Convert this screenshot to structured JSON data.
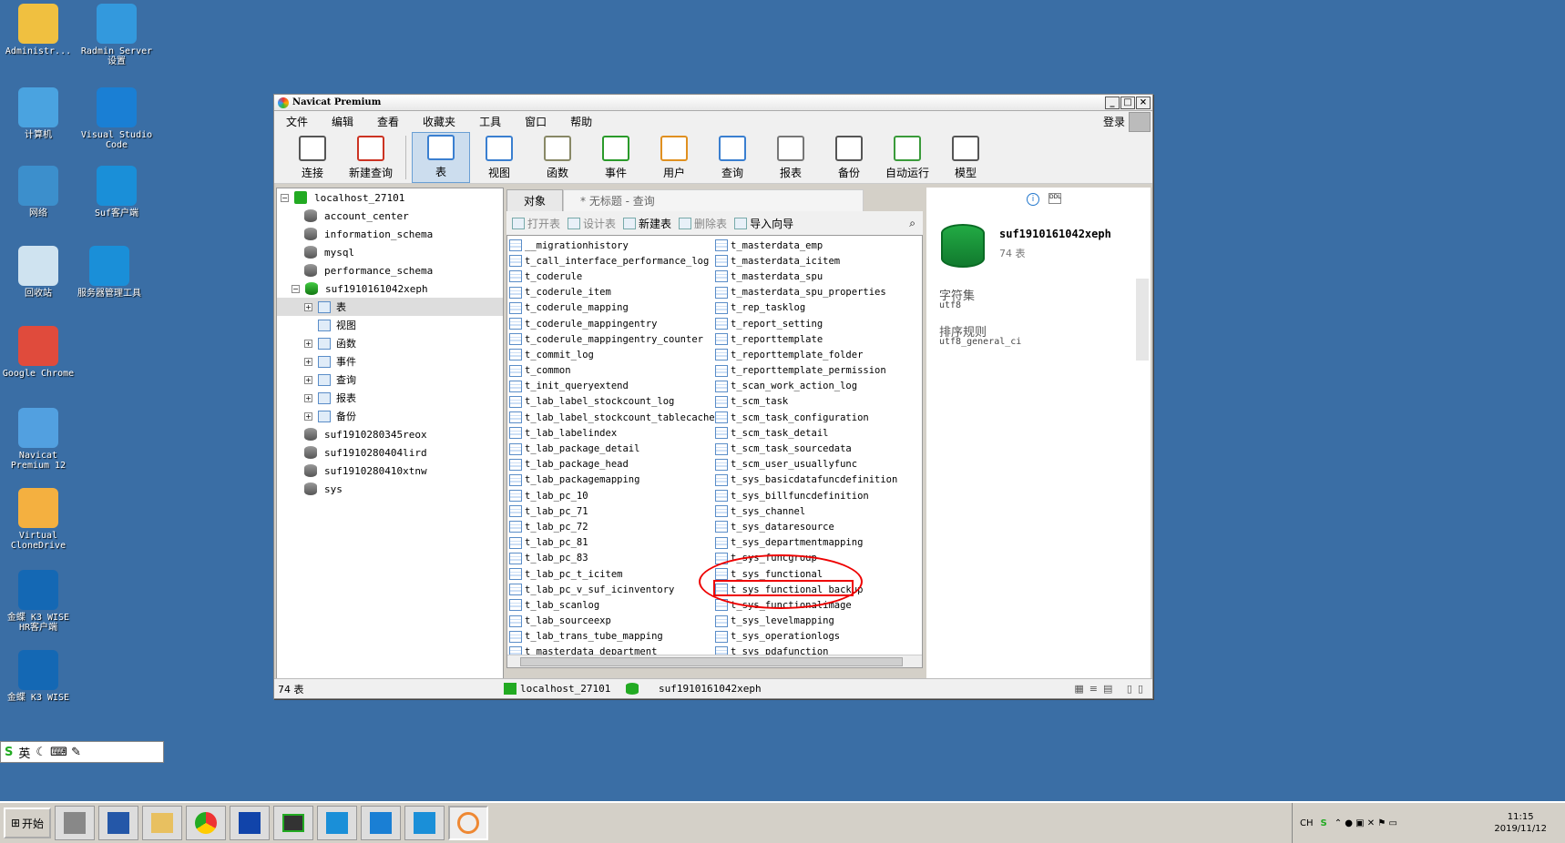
{
  "desktop": {
    "icons": [
      {
        "label": "Administr...",
        "color": "#f0c040"
      },
      {
        "label": "Radmin Server 设置",
        "color": "#3399dd"
      },
      {
        "label": "计算机",
        "color": "#4aa3e0"
      },
      {
        "label": "Visual Studio Code",
        "color": "#1a7fd4"
      },
      {
        "label": "网络",
        "color": "#3c8fcc"
      },
      {
        "label": "Suf客户端",
        "color": "#1a8fd8"
      },
      {
        "label": "回收站",
        "color": "#cfe3f0"
      },
      {
        "label": "服务器管理工具",
        "color": "#1a8fd8"
      },
      {
        "label": "Google Chrome",
        "color": "#e04b3c"
      },
      {
        "label": "Navicat Premium 12",
        "color": "#52a0e0"
      },
      {
        "label": "Virtual CloneDrive",
        "color": "#f4b040"
      },
      {
        "label": "金蝶 K3 WISE HR客户端",
        "color": "#1468b4"
      },
      {
        "label": "金蝶 K3 WISE",
        "color": "#1468b4"
      }
    ]
  },
  "window": {
    "title": "Navicat Premium",
    "menu": [
      "文件",
      "编辑",
      "查看",
      "收藏夹",
      "工具",
      "窗口",
      "帮助"
    ],
    "login": "登录",
    "toolbar": [
      {
        "label": "连接",
        "icon": "connect-icon"
      },
      {
        "label": "新建查询",
        "icon": "new-query-icon"
      },
      {
        "label": "表",
        "icon": "table-icon"
      },
      {
        "label": "视图",
        "icon": "view-icon"
      },
      {
        "label": "函数",
        "icon": "function-icon"
      },
      {
        "label": "事件",
        "icon": "event-icon"
      },
      {
        "label": "用户",
        "icon": "user-icon"
      },
      {
        "label": "查询",
        "icon": "query-icon"
      },
      {
        "label": "报表",
        "icon": "report-icon"
      },
      {
        "label": "备份",
        "icon": "backup-icon"
      },
      {
        "label": "自动运行",
        "icon": "automation-icon"
      },
      {
        "label": "模型",
        "icon": "model-icon"
      }
    ],
    "tree": {
      "connection": "localhost_27101",
      "databases_top": [
        "account_center",
        "information_schema",
        "mysql",
        "performance_schema"
      ],
      "active_db": "suf1910161042xeph",
      "children": [
        "表",
        "视图",
        "函数",
        "事件",
        "查询",
        "报表",
        "备份"
      ],
      "databases_bottom": [
        "suf1910280345reox",
        "suf1910280404lird",
        "suf1910280410xtnw",
        "sys"
      ]
    },
    "tabs": {
      "objects": "对象",
      "untitled": "* 无标题 - 查询"
    },
    "objbar": {
      "open": "打开表",
      "design": "设计表",
      "new": "新建表",
      "delete": "删除表",
      "import": "导入向导"
    },
    "tables_col1": [
      "__migrationhistory",
      "t_call_interface_performance_log",
      "t_coderule",
      "t_coderule_item",
      "t_coderule_mapping",
      "t_coderule_mappingentry",
      "t_coderule_mappingentry_counter",
      "t_commit_log",
      "t_common",
      "t_init_queryextend",
      "t_lab_label_stockcount_log",
      "t_lab_label_stockcount_tablecache",
      "t_lab_labelindex",
      "t_lab_package_detail",
      "t_lab_package_head",
      "t_lab_packagemapping",
      "t_lab_pc_10",
      "t_lab_pc_71",
      "t_lab_pc_72",
      "t_lab_pc_81",
      "t_lab_pc_83",
      "t_lab_pc_t_icitem",
      "t_lab_pc_v_suf_icinventory",
      "t_lab_scanlog",
      "t_lab_sourceexp",
      "t_lab_trans_tube_mapping",
      "t_masterdata_department"
    ],
    "tables_col2": [
      "t_masterdata_emp",
      "t_masterdata_icitem",
      "t_masterdata_spu",
      "t_masterdata_spu_properties",
      "t_rep_tasklog",
      "t_report_setting",
      "t_reporttemplate",
      "t_reporttemplate_folder",
      "t_reporttemplate_permission",
      "t_scan_work_action_log",
      "t_scm_task",
      "t_scm_task_configuration",
      "t_scm_task_detail",
      "t_scm_task_sourcedata",
      "t_scm_user_usuallyfunc",
      "t_sys_basicdatafuncdefinition",
      "t_sys_billfuncdefinition",
      "t_sys_channel",
      "t_sys_dataresource",
      "t_sys_departmentmapping",
      "t_sys_funcgroup",
      "t_sys_functional",
      "t_sys_functional_backup",
      "t_sys_functionalimage",
      "t_sys_levelmapping",
      "t_sys_operationlogs",
      "t_sys_pdafunction"
    ],
    "info": {
      "db_name": "suf1910161042xeph",
      "table_count": "74 表",
      "charset_label": "字符集",
      "charset": "utf8",
      "collation_label": "排序规则",
      "collation": "utf8_general_ci"
    },
    "status": {
      "count": "74 表",
      "connection": "localhost_27101",
      "db": "suf1910161042xeph"
    }
  },
  "ime": {
    "lang": "英"
  },
  "taskbar": {
    "start": "开始",
    "lang": "CH",
    "time": "11:15",
    "date": "2019/11/12"
  }
}
